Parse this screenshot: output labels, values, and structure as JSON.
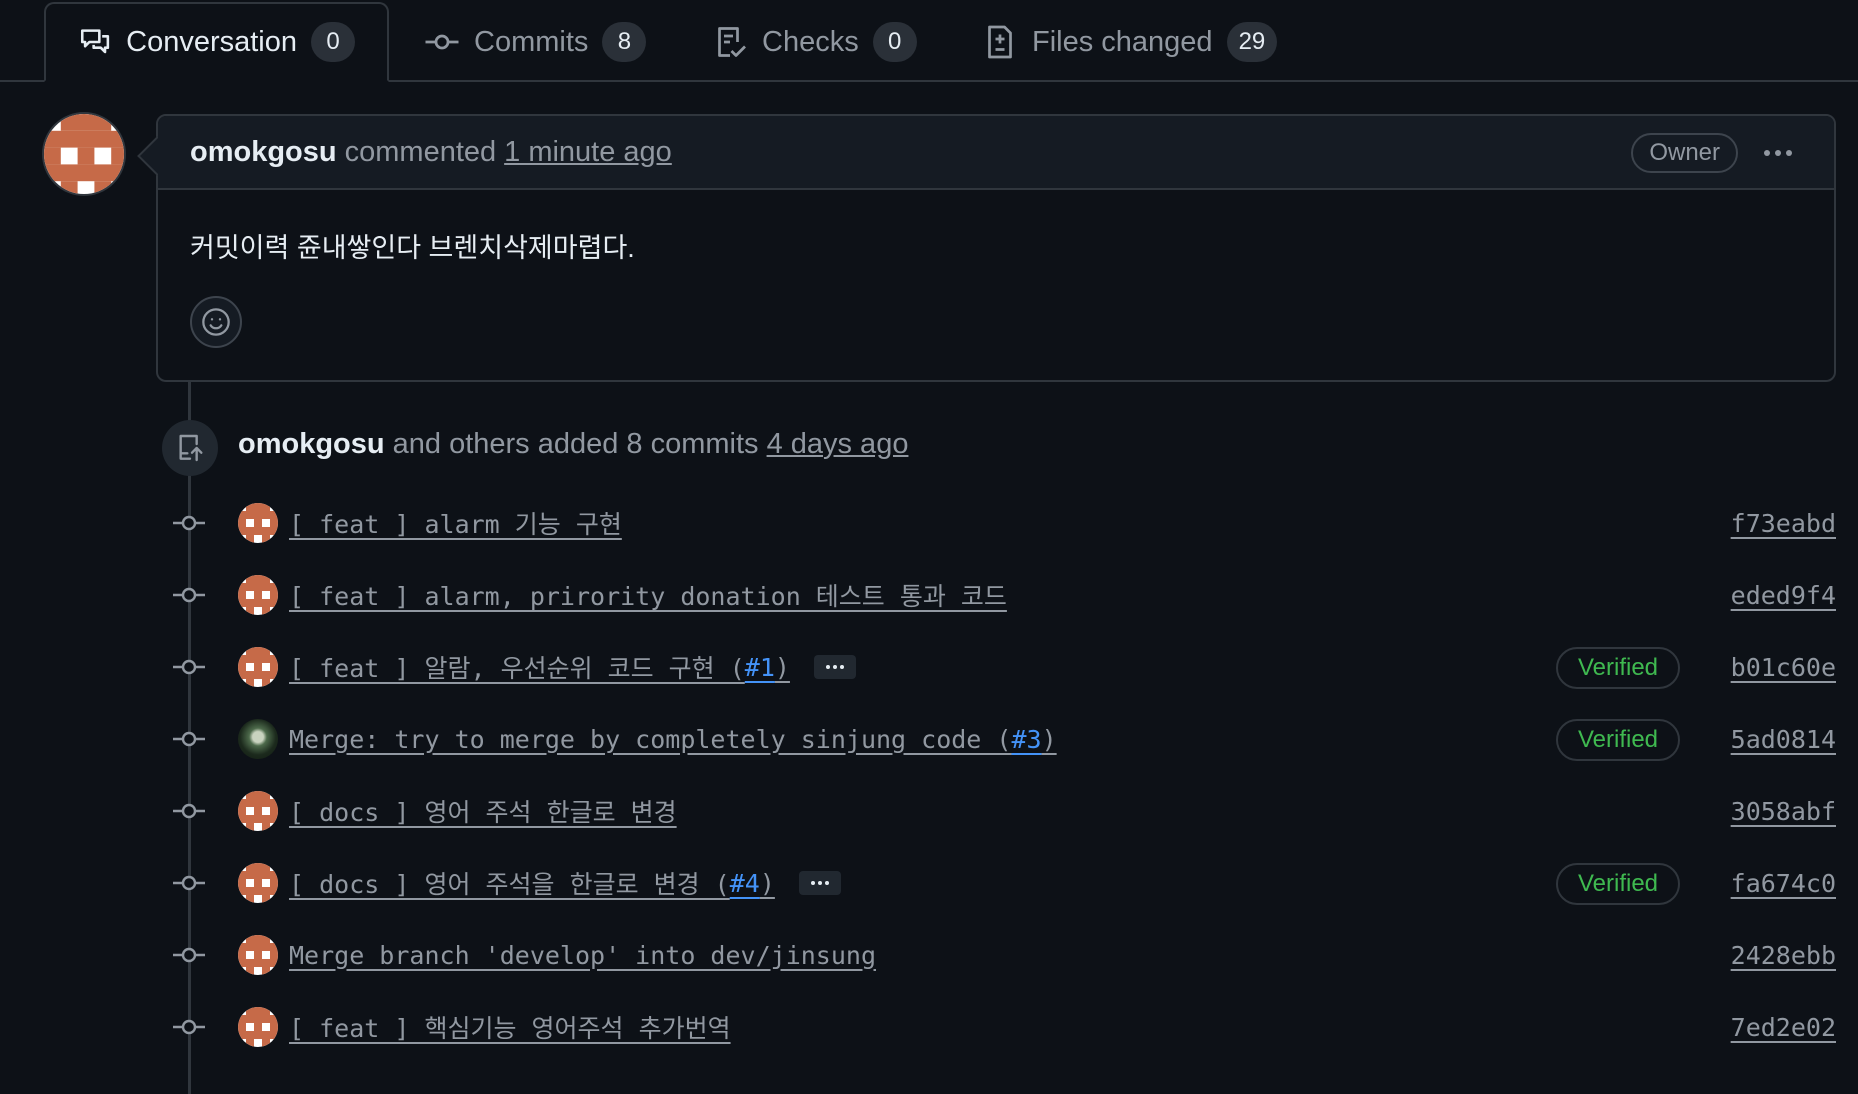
{
  "tabs": [
    {
      "label": "Conversation",
      "count": "0",
      "icon": "comment-discussion-icon",
      "active": true
    },
    {
      "label": "Commits",
      "count": "8",
      "icon": "git-commit-icon",
      "active": false
    },
    {
      "label": "Checks",
      "count": "0",
      "icon": "checklist-icon",
      "active": false
    },
    {
      "label": "Files changed",
      "count": "29",
      "icon": "file-diff-icon",
      "active": false
    }
  ],
  "comment": {
    "author": "omokgosu",
    "verb": "commented",
    "time": "1 minute ago",
    "role_badge": "Owner",
    "body": "커밋이력 쥰내쌓인다 브렌치삭제마렵다."
  },
  "push_event": {
    "author": "omokgosu",
    "text": "and others added 8 commits",
    "time": "4 days ago"
  },
  "commits": [
    {
      "message": "[ feat ] alarm 기능 구현",
      "ref": "",
      "has_more": false,
      "verified": false,
      "sha": "f73eabd",
      "avatar": "identicon"
    },
    {
      "message": "[ feat ] alarm, prirority_donation 테스트 통과 코드",
      "ref": "",
      "has_more": false,
      "verified": false,
      "sha": "eded9f4",
      "avatar": "identicon"
    },
    {
      "message": "[ feat ] 알람, 우선순위 코드 구현 (",
      "ref": "#1",
      "has_more": true,
      "verified": true,
      "verified_label": "Verified",
      "sha": "b01c60e",
      "avatar": "identicon"
    },
    {
      "message": "Merge: try to merge by completely sinjung code (",
      "ref": "#3",
      "has_more": false,
      "verified": true,
      "verified_label": "Verified",
      "sha": "5ad0814",
      "avatar": "photo"
    },
    {
      "message": "[ docs ] 영어 주석 한글로 변경",
      "ref": "",
      "has_more": false,
      "verified": false,
      "sha": "3058abf",
      "avatar": "identicon"
    },
    {
      "message": "[ docs ] 영어 주석을 한글로 변경 (",
      "ref": "#4",
      "has_more": true,
      "verified": true,
      "verified_label": "Verified",
      "sha": "fa674c0",
      "avatar": "identicon"
    },
    {
      "message": "Merge branch 'develop' into dev/jinsung",
      "ref": "",
      "has_more": false,
      "verified": false,
      "sha": "2428ebb",
      "avatar": "identicon"
    },
    {
      "message": "[ feat ] 핵심기능 영어주석 추가번역",
      "ref": "",
      "has_more": false,
      "verified": false,
      "sha": "7ed2e02",
      "avatar": "identicon"
    }
  ],
  "colors": {
    "background": "#0d1117",
    "border": "#30363d",
    "muted_text": "#9198a1",
    "link_blue": "#4493f8",
    "verified_green": "#3fb950",
    "identicon": "#c66a48"
  }
}
